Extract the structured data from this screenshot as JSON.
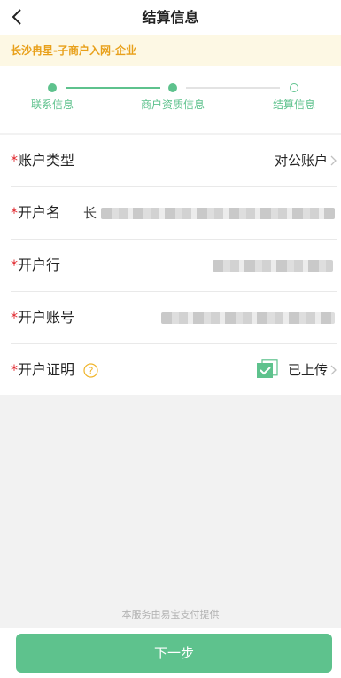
{
  "header": {
    "title": "结算信息",
    "back_icon": "chevron-left-icon"
  },
  "banner": {
    "text": "长沙冉星-子商户入网-企业"
  },
  "steps": [
    {
      "label": "联系信息",
      "state": "done"
    },
    {
      "label": "商户资质信息",
      "state": "current"
    },
    {
      "label": "结算信息",
      "state": "pending"
    }
  ],
  "form": {
    "required_mark": "*",
    "account_type": {
      "label": "账户类型",
      "value": "对公账户"
    },
    "account_name": {
      "label": "开户名",
      "value_prefix": "长"
    },
    "bank": {
      "label": "开户行"
    },
    "account_number": {
      "label": "开户账号"
    },
    "certificate": {
      "label": "开户证明",
      "value": "已上传"
    }
  },
  "footer": {
    "note": "本服务由易宝支付提供",
    "next_button": "下一步"
  },
  "colors": {
    "accent": "#5ec28d",
    "banner_text": "#e8a01a",
    "banner_bg": "#fdf8e4",
    "required": "#e0252b",
    "help_icon": "#f0b429"
  }
}
